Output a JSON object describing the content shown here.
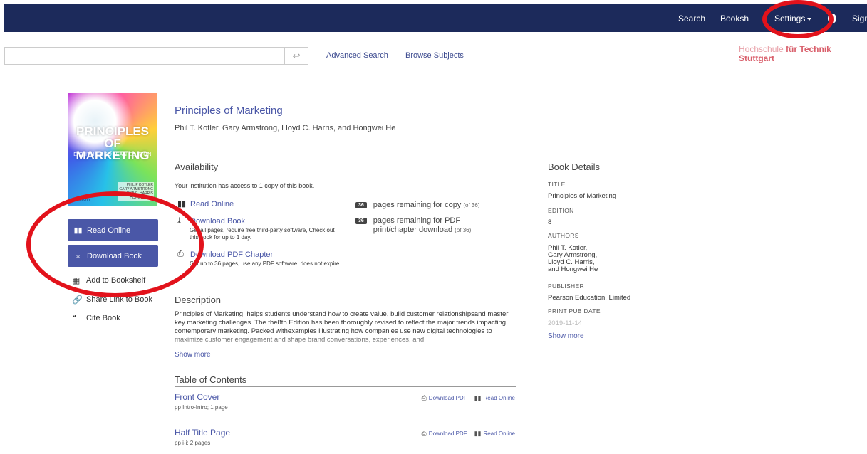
{
  "nav": {
    "search": "Search",
    "bookshelf": "Bookshelf",
    "settings": "Settings",
    "signin": "Sign in"
  },
  "searchbar": {
    "value": "",
    "submit_icon": "return-arrow-icon",
    "advanced_search": "Advanced Search",
    "browse_subjects": "Browse Subjects"
  },
  "institution": {
    "name_light": "Hochschule ",
    "name_bold": "für Technik",
    "city": "Stuttgart",
    "color": "#d9606c"
  },
  "cover": {
    "title": "PRINCIPLES OF MARKETING",
    "edition": "EIGHTH EUROPEAN EDITION",
    "authors": "PHILIP KOTLER\nGARY ARMSTRONG\nLLOYD C. HARRIS\nHONGWEI HE",
    "publisher": "Pearson"
  },
  "sidebar": {
    "read_online": "Read Online",
    "download_book": "Download Book",
    "add_to_bookshelf": "Add to Bookshelf",
    "share_link": "Share Link to Book",
    "cite_book": "Cite Book"
  },
  "book": {
    "title": "Principles of Marketing",
    "authors": "Phil T. Kotler, Gary Armstrong, Lloyd C. Harris, and Hongwei He"
  },
  "availability": {
    "heading": "Availability",
    "note": "Your institution has access to 1 copy of this book.",
    "read_online": "Read Online",
    "download_book": "Download Book",
    "download_book_sub": "Get all pages, require free third-party software, Check out this book for up to 1 day.",
    "download_pdf": "Download PDF Chapter",
    "download_pdf_sub": "Get up to 36 pages, use any PDF software, does not expire.",
    "copy_badge": "36",
    "copy_text": "pages remaining for copy",
    "copy_of": "(of 36)",
    "pdf_badge": "36",
    "pdf_text_1": "pages remaining for PDF",
    "pdf_text_2": "print/chapter download",
    "pdf_of": "(of 36)"
  },
  "description": {
    "heading": "Description",
    "text": "Principles of Marketing, helps students understand how to create value, build customer relationshipsand master key marketing challenges. The the8th Edition has been thoroughly revised to reflect the major trends impacting contemporary marketing. Packed withexamples illustrating how companies use new digital technologies to maximize customer engagement and shape brand conversations, experiences, and",
    "show_more": "Show more"
  },
  "toc": {
    "heading": "Table of Contents",
    "rows": [
      {
        "title": "Front Cover",
        "pages": "pp Intro-Intro; 1 page",
        "download": "Download PDF",
        "read": "Read Online"
      },
      {
        "title": "Half Title Page",
        "pages": "pp i-i; 2 pages",
        "download": "Download PDF",
        "read": "Read Online"
      }
    ]
  },
  "details": {
    "heading": "Book Details",
    "title_label": "TITLE",
    "title_value": "Principles of Marketing",
    "edition_label": "EDITION",
    "edition_value": "8",
    "authors_label": "AUTHORS",
    "authors_value": [
      "Phil T. Kotler,",
      "Gary Armstrong,",
      "Lloyd C. Harris,",
      "and Hongwei He"
    ],
    "publisher_label": "PUBLISHER",
    "publisher_value": "Pearson Education, Limited",
    "pubdate_label": "PRINT PUB DATE",
    "pubdate_value": "2019-11-14",
    "show_more": "Show more"
  },
  "colors": {
    "navbar": "#1c2a5b",
    "accent": "#4a57a7",
    "annotation": "#e2121b"
  }
}
